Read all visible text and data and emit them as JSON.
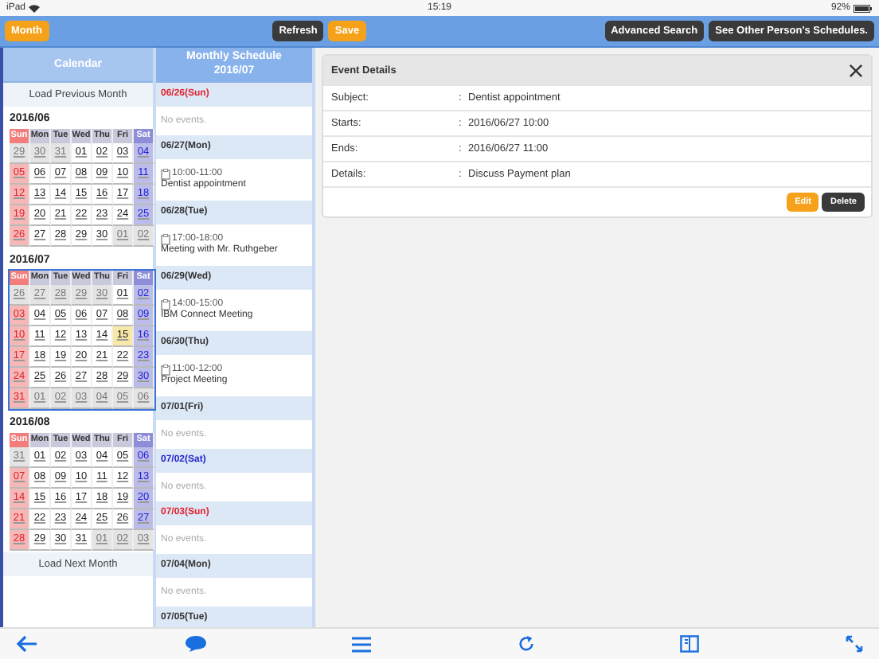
{
  "status_bar": {
    "device": "iPad",
    "time": "15:19",
    "battery": "92%"
  },
  "toolbar": {
    "left_buttons": [
      {
        "label": "Month",
        "kind": "accent"
      }
    ],
    "center_buttons": [
      {
        "label": "Refresh",
        "kind": "dark"
      },
      {
        "label": "Save",
        "kind": "accent"
      }
    ],
    "right_buttons": [
      {
        "label": "Advanced Search",
        "kind": "dark"
      },
      {
        "label": "See Other Person's Schedules.",
        "kind": "dark"
      }
    ]
  },
  "calendar": {
    "title": "Calendar",
    "load_previous": "Load Previous Month",
    "load_next": "Load Next Month",
    "months": [
      {
        "title": "2016/06",
        "selected": false,
        "weekdays": [
          "Sun",
          "Mon",
          "Tue",
          "Wed",
          "Thu",
          "Fri",
          "Sat"
        ],
        "weeks": [
          [
            {
              "day": "29",
              "other": true
            },
            {
              "day": "30",
              "other": true
            },
            {
              "day": "31",
              "other": true
            },
            {
              "day": "01"
            },
            {
              "day": "02"
            },
            {
              "day": "03"
            },
            {
              "day": "04"
            }
          ],
          [
            {
              "day": "05"
            },
            {
              "day": "06"
            },
            {
              "day": "07"
            },
            {
              "day": "08"
            },
            {
              "day": "09"
            },
            {
              "day": "10"
            },
            {
              "day": "11"
            }
          ],
          [
            {
              "day": "12"
            },
            {
              "day": "13"
            },
            {
              "day": "14"
            },
            {
              "day": "15"
            },
            {
              "day": "16"
            },
            {
              "day": "17"
            },
            {
              "day": "18"
            }
          ],
          [
            {
              "day": "19"
            },
            {
              "day": "20"
            },
            {
              "day": "21"
            },
            {
              "day": "22"
            },
            {
              "day": "23"
            },
            {
              "day": "24"
            },
            {
              "day": "25"
            }
          ],
          [
            {
              "day": "26"
            },
            {
              "day": "27"
            },
            {
              "day": "28"
            },
            {
              "day": "29"
            },
            {
              "day": "30"
            },
            {
              "day": "01",
              "other": true
            },
            {
              "day": "02",
              "other": true
            }
          ]
        ]
      },
      {
        "title": "2016/07",
        "selected": true,
        "weekdays": [
          "Sun",
          "Mon",
          "Tue",
          "Wed",
          "Thu",
          "Fri",
          "Sat"
        ],
        "weeks": [
          [
            {
              "day": "26",
              "other": true
            },
            {
              "day": "27",
              "other": true
            },
            {
              "day": "28",
              "other": true
            },
            {
              "day": "29",
              "other": true
            },
            {
              "day": "30",
              "other": true
            },
            {
              "day": "01"
            },
            {
              "day": "02"
            }
          ],
          [
            {
              "day": "03"
            },
            {
              "day": "04"
            },
            {
              "day": "05"
            },
            {
              "day": "06"
            },
            {
              "day": "07"
            },
            {
              "day": "08"
            },
            {
              "day": "09"
            }
          ],
          [
            {
              "day": "10"
            },
            {
              "day": "11"
            },
            {
              "day": "12"
            },
            {
              "day": "13"
            },
            {
              "day": "14"
            },
            {
              "day": "15",
              "today": true
            },
            {
              "day": "16"
            }
          ],
          [
            {
              "day": "17"
            },
            {
              "day": "18"
            },
            {
              "day": "19"
            },
            {
              "day": "20"
            },
            {
              "day": "21"
            },
            {
              "day": "22"
            },
            {
              "day": "23"
            }
          ],
          [
            {
              "day": "24"
            },
            {
              "day": "25"
            },
            {
              "day": "26"
            },
            {
              "day": "27"
            },
            {
              "day": "28"
            },
            {
              "day": "29"
            },
            {
              "day": "30"
            }
          ],
          [
            {
              "day": "31"
            },
            {
              "day": "01",
              "other": true
            },
            {
              "day": "02",
              "other": true
            },
            {
              "day": "03",
              "other": true
            },
            {
              "day": "04",
              "other": true
            },
            {
              "day": "05",
              "other": true
            },
            {
              "day": "06",
              "other": true
            }
          ]
        ]
      },
      {
        "title": "2016/08",
        "selected": false,
        "weekdays": [
          "Sun",
          "Mon",
          "Tue",
          "Wed",
          "Thu",
          "Fri",
          "Sat"
        ],
        "weeks": [
          [
            {
              "day": "31",
              "other": true
            },
            {
              "day": "01"
            },
            {
              "day": "02"
            },
            {
              "day": "03"
            },
            {
              "day": "04"
            },
            {
              "day": "05"
            },
            {
              "day": "06"
            }
          ],
          [
            {
              "day": "07"
            },
            {
              "day": "08"
            },
            {
              "day": "09"
            },
            {
              "day": "10"
            },
            {
              "day": "11"
            },
            {
              "day": "12"
            },
            {
              "day": "13"
            }
          ],
          [
            {
              "day": "14"
            },
            {
              "day": "15"
            },
            {
              "day": "16"
            },
            {
              "day": "17"
            },
            {
              "day": "18"
            },
            {
              "day": "19"
            },
            {
              "day": "20"
            }
          ],
          [
            {
              "day": "21"
            },
            {
              "day": "22"
            },
            {
              "day": "23"
            },
            {
              "day": "24"
            },
            {
              "day": "25"
            },
            {
              "day": "26"
            },
            {
              "day": "27"
            }
          ],
          [
            {
              "day": "28"
            },
            {
              "day": "29"
            },
            {
              "day": "30"
            },
            {
              "day": "31"
            },
            {
              "day": "01",
              "other": true
            },
            {
              "day": "02",
              "other": true
            },
            {
              "day": "03",
              "other": true
            }
          ]
        ]
      }
    ]
  },
  "schedule": {
    "title": "Monthly Schedule",
    "month": "2016/07",
    "days": [
      {
        "date": "06/26(Sun)",
        "kind": "sunday",
        "empty_text": "No events."
      },
      {
        "date": "06/27(Mon)",
        "kind": "weekday",
        "events": [
          {
            "time": "10:00-11:00",
            "title": "Dentist appointment"
          }
        ]
      },
      {
        "date": "06/28(Tue)",
        "kind": "weekday",
        "events": [
          {
            "time": "17:00-18:00",
            "title": "Meeting with Mr. Ruthgeber"
          }
        ]
      },
      {
        "date": "06/29(Wed)",
        "kind": "weekday",
        "events": [
          {
            "time": "14:00-15:00",
            "title": "IBM Connect Meeting"
          }
        ]
      },
      {
        "date": "06/30(Thu)",
        "kind": "weekday",
        "events": [
          {
            "time": "11:00-12:00",
            "title": "Project Meeting"
          }
        ]
      },
      {
        "date": "07/01(Fri)",
        "kind": "weekday",
        "empty_text": "No events."
      },
      {
        "date": "07/02(Sat)",
        "kind": "saturday",
        "empty_text": "No events."
      },
      {
        "date": "07/03(Sun)",
        "kind": "sunday",
        "empty_text": "No events."
      },
      {
        "date": "07/04(Mon)",
        "kind": "weekday",
        "empty_text": "No events."
      },
      {
        "date": "07/05(Tue)",
        "kind": "weekday"
      }
    ]
  },
  "event_details": {
    "title": "Event Details",
    "fields": [
      {
        "label": "Subject:",
        "separator": ":",
        "value": "Dentist appointment"
      },
      {
        "label": "Starts:",
        "separator": ":",
        "value": "2016/06/27 10:00"
      },
      {
        "label": "Ends:",
        "separator": ":",
        "value": "2016/06/27 11:00"
      },
      {
        "label": "Details:",
        "separator": ":",
        "value": "Discuss Payment plan"
      }
    ],
    "buttons": [
      {
        "label": "Edit",
        "kind": "accent"
      },
      {
        "label": "Delete",
        "kind": "dark"
      }
    ]
  },
  "bottom_bar": {
    "icons": [
      {
        "kind": "back"
      },
      {
        "kind": "chat"
      },
      {
        "kind": "menu"
      },
      {
        "kind": "refresh"
      },
      {
        "kind": "panel"
      },
      {
        "kind": "expand"
      }
    ]
  }
}
